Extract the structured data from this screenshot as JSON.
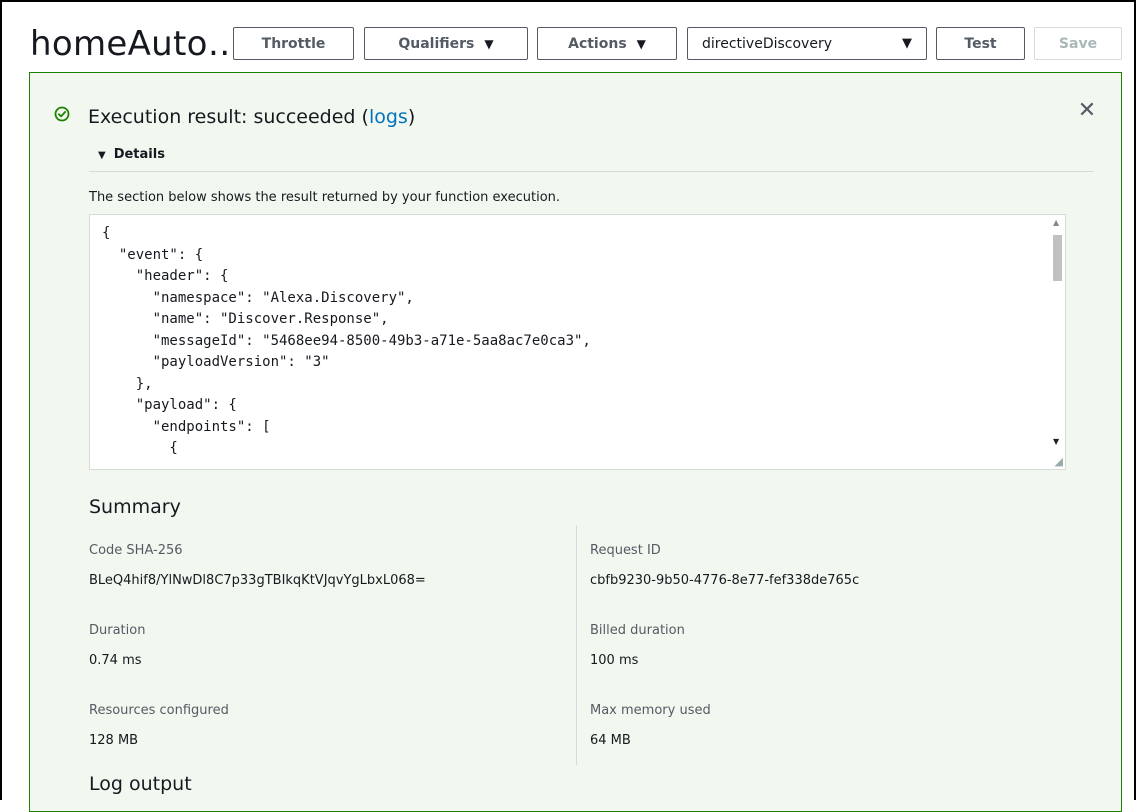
{
  "toolbar": {
    "app_title": "homeAuto…",
    "throttle_label": "Throttle",
    "qualifiers_label": "Qualifiers",
    "actions_label": "Actions",
    "test_event_selected": "directiveDiscovery",
    "test_label": "Test",
    "save_label": "Save"
  },
  "result": {
    "title_prefix": "Execution result: succeeded (",
    "logs_link": "logs",
    "title_suffix": ")",
    "status": "succeeded",
    "status_color": "#1d8102",
    "details_label": "Details",
    "details_desc": "The section below shows the result returned by your function execution.",
    "code_lines": [
      "{",
      "  \"event\": {",
      "    \"header\": {",
      "      \"namespace\": \"Alexa.Discovery\",",
      "      \"name\": \"Discover.Response\",",
      "      \"messageId\": \"5468ee94-8500-49b3-a71e-5aa8ac7e0ca3\",",
      "      \"payloadVersion\": \"3\"",
      "    },",
      "    \"payload\": {",
      "      \"endpoints\": [",
      "        {"
    ]
  },
  "summary": {
    "title": "Summary",
    "code_sha_label": "Code SHA-256",
    "code_sha_value": "BLeQ4hif8/YlNwDl8C7p33gTBIkqKtVJqvYgLbxL068=",
    "request_id_label": "Request ID",
    "request_id_value": "cbfb9230-9b50-4776-8e77-fef338de765c",
    "duration_label": "Duration",
    "duration_value": "0.74 ms",
    "billed_label": "Billed duration",
    "billed_value": "100 ms",
    "resources_label": "Resources configured",
    "resources_value": "128 MB",
    "max_memory_label": "Max memory used",
    "max_memory_value": "64 MB"
  },
  "log_output": {
    "title": "Log output"
  },
  "icons": {
    "status": "check-circle-icon",
    "close": "close-icon",
    "caret": "caret-down-icon"
  }
}
